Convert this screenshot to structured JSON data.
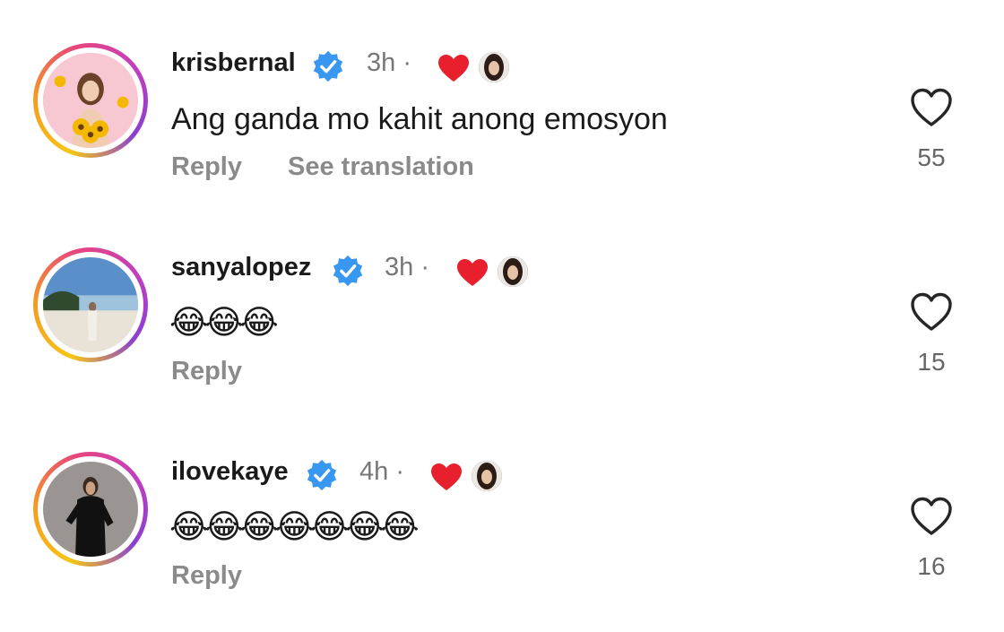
{
  "comments": [
    {
      "username": "krisbernal",
      "time": "3h ·",
      "text": "Ang ganda mo kahit anong emosyon",
      "emojis": "",
      "actions": {
        "reply": "Reply",
        "translate": "See translation"
      },
      "likes": "55"
    },
    {
      "username": "sanyalopez",
      "time": "3h ·",
      "text": "",
      "emojis": "😂😂😂",
      "actions": {
        "reply": "Reply"
      },
      "likes": "15"
    },
    {
      "username": "ilovekaye",
      "time": "4h ·",
      "text": "",
      "emojis": "😂😂😂😂😂😂😂",
      "actions": {
        "reply": "Reply"
      },
      "likes": "16"
    }
  ],
  "colors": {
    "verified": "#3897f0",
    "liked_by_creator_heart": "#e8202e",
    "secondary_text": "#8a8a8a"
  },
  "icons": {
    "verified": "verified-badge-icon",
    "creator_heart": "heart-filled-icon",
    "like": "heart-outline-icon"
  }
}
